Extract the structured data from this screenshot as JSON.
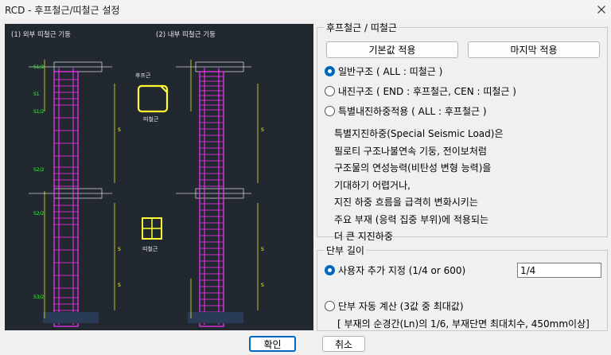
{
  "window": {
    "title": "RCD - 후프철근/띠철근 설정",
    "close_icon": "close-icon"
  },
  "drawing": {
    "label_left": "(1) 외부 띠철근 기둥",
    "label_right": "(2) 내부 띠철근 기둥",
    "hoop_label": "후프근",
    "tie_label": "띠철근",
    "tie2_label": "띠철근"
  },
  "group_hoop": {
    "title": "후프철근 / 띠철근",
    "btn_default": "기본값 적용",
    "btn_last": "마지막 적용",
    "options": [
      {
        "label": "일반구조 ( ALL : 띠철근 )",
        "checked": true
      },
      {
        "label": "내진구조 ( END : 후프철근, CEN : 띠철근 )",
        "checked": false
      },
      {
        "label": "특별내진하중적용 ( ALL : 후프철근 )",
        "checked": false
      }
    ],
    "description": [
      "특별지진하중(Special Seismic Load)은",
      "필로티 구조나불연속 기둥, 전이보처럼",
      "구조물의 연성능력(비탄성 변형 능력)을",
      "기대하기 어렵거나,",
      "지진 하중 흐름을 급격히 변화시키는",
      "주요 부재 (응력 집중 부위)에 적용되는",
      "더 큰 지진하중"
    ]
  },
  "group_end": {
    "title": "단부 길이",
    "option_user": "사용자 추가 지정 (1/4 or 600)",
    "option_user_checked": true,
    "input_value": "1/4",
    "option_auto": "단부 자동 계산 (3값 중 최대값)",
    "option_auto_checked": false,
    "note": "[ 부재의 순경간(Ln)의 1/6, 부재단면 최대치수, 450mm이상]"
  },
  "footer": {
    "ok": "확인",
    "cancel": "취소"
  },
  "colors": {
    "accent": "#0067c0",
    "cad_bg": "#212830",
    "rebar": "#ff33ff",
    "dim": "#ffff33",
    "note": "#33ff33"
  }
}
